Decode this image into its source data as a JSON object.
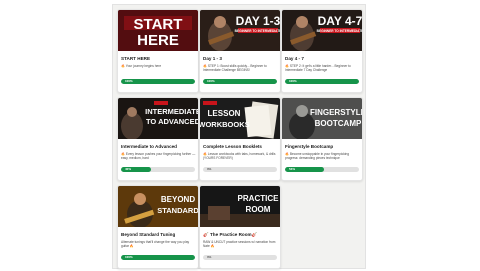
{
  "courses": [
    {
      "title": "START HERE",
      "thumb_text": "START HERE",
      "description": "🔥 Your journey begins here",
      "progress": 100,
      "progress_label": "100%"
    },
    {
      "title": "Day 1 - 3",
      "thumb_text": "DAY 1-3",
      "thumb_badge": "BEGINNER TO INTERMEDIATE",
      "description": "🔥 STEP 1: Boost skills quickly... Beginner to Intermediate Challenge BEGINS!",
      "progress": 100,
      "progress_label": "100%"
    },
    {
      "title": "Day 4 - 7",
      "thumb_text": "DAY 4-7",
      "thumb_badge": "BEGINNER TO INTERMEDIATE",
      "description": "🔥 STEP 2: It get's a little harder... Beginner to Intermediate 7 Day Challenge",
      "progress": 100,
      "progress_label": "100%"
    },
    {
      "title": "Intermediate to Advanced",
      "thumb_text": "INTERMEDIATE TO ADVANCED",
      "description": "🔥 Every lesson pushes your fingerpicking further — easy, medium, hard",
      "progress": 40,
      "progress_label": "40%"
    },
    {
      "title": "Complete Lesson Booklets",
      "thumb_text": "LESSON WORKBOOKS",
      "description": "🔥 Lesson workbooks with tabs, homework, & drills (YOURS FOREVER)",
      "progress": 0,
      "progress_label": "0%"
    },
    {
      "title": "Fingerstyle Bootcamp",
      "thumb_text": "FINGERSTYLE BOOTCAMP",
      "description": "🔥 Become unstoppable in your fingerpicking progress: demanding pieces technique",
      "progress": 53,
      "progress_label": "53%"
    },
    {
      "title": "Beyond Standard Tuning",
      "thumb_text": "BEYOND STANDARD",
      "description": "Alternate tunings that'll change the way you play guitar 🔥",
      "progress": 100,
      "progress_label": "100%"
    },
    {
      "title": "🎸 The Practice Room🎸",
      "thumb_text": "PRACTICE ROOM",
      "description": "RAW & UNCUT practice sessions w/ narration from Nate 🔥",
      "progress": 0,
      "progress_label": "0%"
    }
  ],
  "colors": {
    "accent": "#16944a",
    "thumb_red": "#c8141b",
    "track": "#e1e1e1"
  }
}
